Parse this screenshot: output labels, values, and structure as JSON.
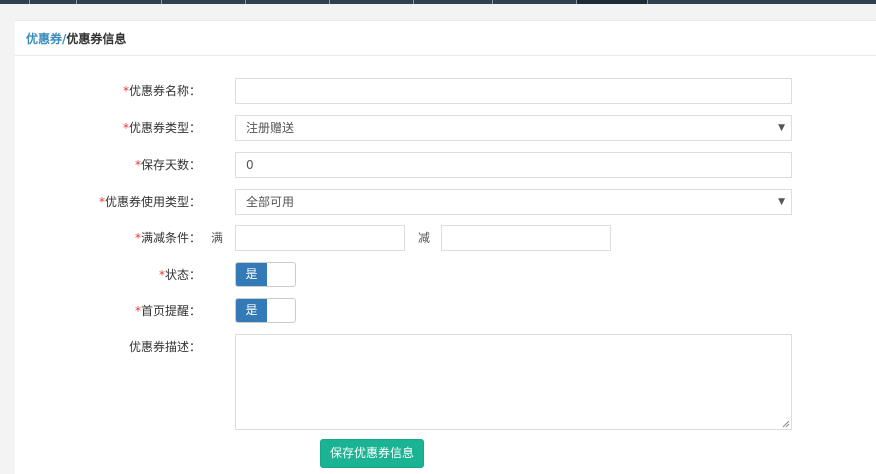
{
  "breadcrumb": {
    "link": "优惠券",
    "separator": "/",
    "current": "优惠券信息"
  },
  "form": {
    "required_mark": "*",
    "name": {
      "label": "优惠券名称：",
      "value": ""
    },
    "type": {
      "label": "优惠券类型：",
      "selected": "注册赠送"
    },
    "days": {
      "label": "保存天数：",
      "value": "0"
    },
    "usage_type": {
      "label": "优惠券使用类型：",
      "selected": "全部可用"
    },
    "condition": {
      "label": "满减条件：",
      "full_label": "满",
      "minus_label": "减",
      "full_value": "",
      "minus_value": ""
    },
    "status": {
      "label": "状态：",
      "toggle_text": "是"
    },
    "homepage_remind": {
      "label": "首页提醒：",
      "toggle_text": "是"
    },
    "description": {
      "label": "优惠券描述：",
      "value": ""
    }
  },
  "actions": {
    "save_label": "保存优惠券信息"
  },
  "colors": {
    "accent_blue": "#337ab7",
    "save_green": "#1ab394",
    "required_red": "#e4393c"
  }
}
